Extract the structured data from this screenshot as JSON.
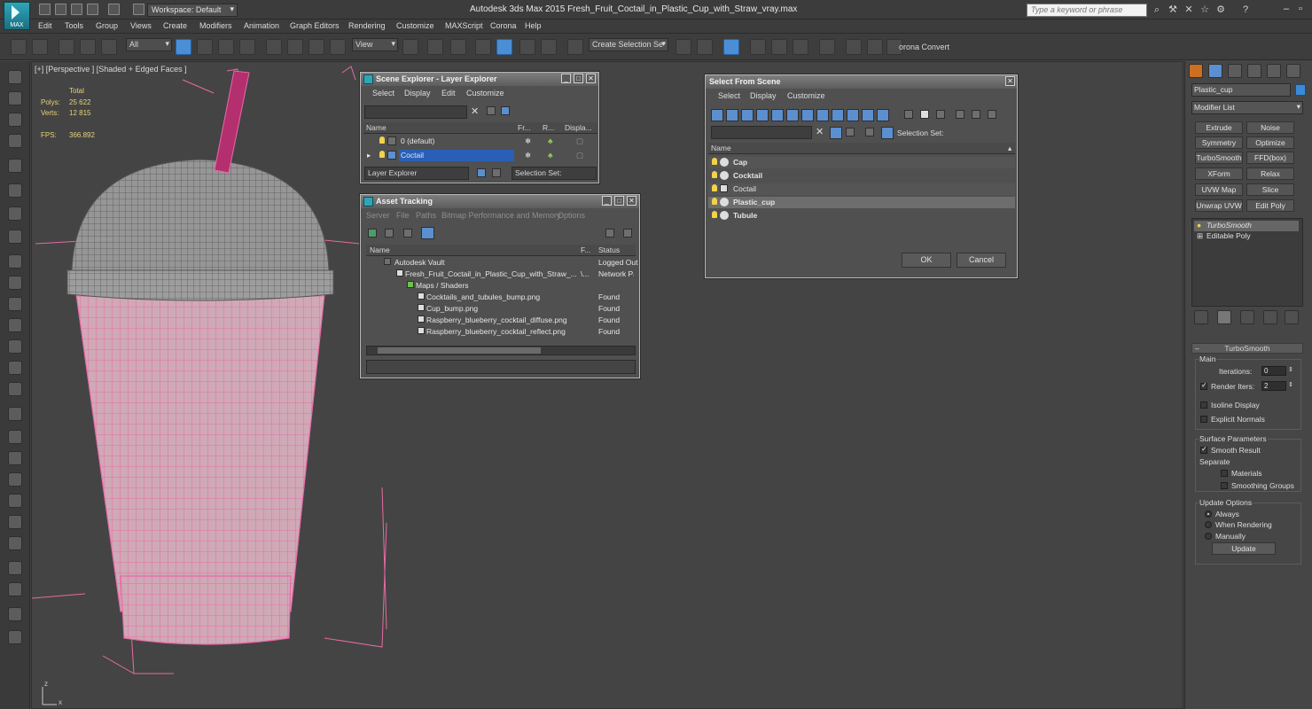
{
  "app": {
    "logo_text": "MAX",
    "workspace": "Workspace: Default",
    "window_title": "Autodesk 3ds Max  2015    Fresh_Fruit_Coctail_in_Plastic_Cup_with_Straw_vray.max",
    "search_placeholder": "Type a keyword or phrase"
  },
  "menu": [
    "Edit",
    "Tools",
    "Group",
    "Views",
    "Create",
    "Modifiers",
    "Animation",
    "Graph Editors",
    "Rendering",
    "Customize",
    "MAXScript",
    "Corona",
    "Help"
  ],
  "toolbar": {
    "filter": "All",
    "ref_coord": "View",
    "selection_set": "Create Selection Se",
    "corona_convert": "orona Convert"
  },
  "viewport": {
    "label": "[+] [Perspective ] [Shaded + Edged Faces ]",
    "stats_total": "Total",
    "polys_label": "Polys:",
    "polys_value": "25 622",
    "verts_label": "Verts:",
    "verts_value": "12 815",
    "fps_label": "FPS:",
    "fps_value": "366.892",
    "axis_z": "z",
    "axis_x": "x"
  },
  "scene_explorer": {
    "title": "Scene Explorer - Layer Explorer",
    "menu": [
      "Select",
      "Display",
      "Edit",
      "Customize"
    ],
    "columns": [
      "Name",
      "Fr...",
      "R...",
      "Displa..."
    ],
    "rows": [
      {
        "name": "0 (default)",
        "selected": false
      },
      {
        "name": "Coctail",
        "selected": true
      }
    ],
    "explorer_dropdown": "Layer Explorer",
    "selection_set_label": "Selection Set:"
  },
  "asset_tracking": {
    "title": "Asset Tracking",
    "menu": [
      "Server",
      "File",
      "Paths",
      "Bitmap Performance and Memory",
      "Options"
    ],
    "columns": [
      "Name",
      "F...",
      "Status"
    ],
    "rows": [
      {
        "name": "Autodesk Vault",
        "f": "",
        "status": "Logged Out"
      },
      {
        "name": "Fresh_Fruit_Coctail_in_Plastic_Cup_with_Straw_...",
        "f": "\\...",
        "status": "Network Pa"
      },
      {
        "name": "Maps / Shaders",
        "f": "",
        "status": ""
      },
      {
        "name": "Cocktails_and_tubules_bump.png",
        "f": "",
        "status": "Found"
      },
      {
        "name": "Cup_bump.png",
        "f": "",
        "status": "Found"
      },
      {
        "name": "Raspberry_blueberry_cocktail_diffuse.png",
        "f": "",
        "status": "Found"
      },
      {
        "name": "Raspberry_blueberry_cocktail_reflect.png",
        "f": "",
        "status": "Found"
      }
    ]
  },
  "select_from_scene": {
    "title": "Select From Scene",
    "menu": [
      "Select",
      "Display",
      "Customize"
    ],
    "selection_set_label": "Selection Set:",
    "column_name": "Name",
    "rows": [
      {
        "name": "Cap",
        "bold": true,
        "selected": false
      },
      {
        "name": "Cocktail",
        "bold": true,
        "selected": false
      },
      {
        "name": "Coctail",
        "bold": false,
        "selected": false
      },
      {
        "name": "Plastic_cup",
        "bold": true,
        "selected": true
      },
      {
        "name": "Tubule",
        "bold": true,
        "selected": false
      }
    ],
    "ok": "OK",
    "cancel": "Cancel"
  },
  "command_panel": {
    "object_name": "Plastic_cup",
    "object_color": "#3c8ad6",
    "modifier_list": "Modifier List",
    "modifier_buttons": [
      "Extrude",
      "Noise",
      "Symmetry",
      "Optimize",
      "TurboSmooth",
      "FFD(box)",
      "XForm",
      "Relax",
      "UVW Map",
      "Slice",
      "Unwrap UVW",
      "Edit Poly"
    ],
    "stack": [
      "TurboSmooth",
      "Editable Poly"
    ],
    "rollout_title": "TurboSmooth",
    "main_label": "Main",
    "iterations_label": "Iterations:",
    "iterations_value": "0",
    "render_iters_label": "Render Iters:",
    "render_iters_value": "2",
    "isoline_display": "Isoline Display",
    "explicit_normals": "Explicit Normals",
    "surface_params": "Surface Parameters",
    "smooth_result": "Smooth Result",
    "separate": "Separate",
    "materials": "Materials",
    "smoothing_groups": "Smoothing Groups",
    "update_options": "Update Options",
    "always": "Always",
    "when_rendering": "When Rendering",
    "manually": "Manually",
    "update_button": "Update"
  },
  "colors": {
    "accent": "#4a8fd6",
    "selection": "#2a5fb8",
    "wire_pink": "#e86aa8",
    "stats_yellow": "#e7d27a"
  }
}
